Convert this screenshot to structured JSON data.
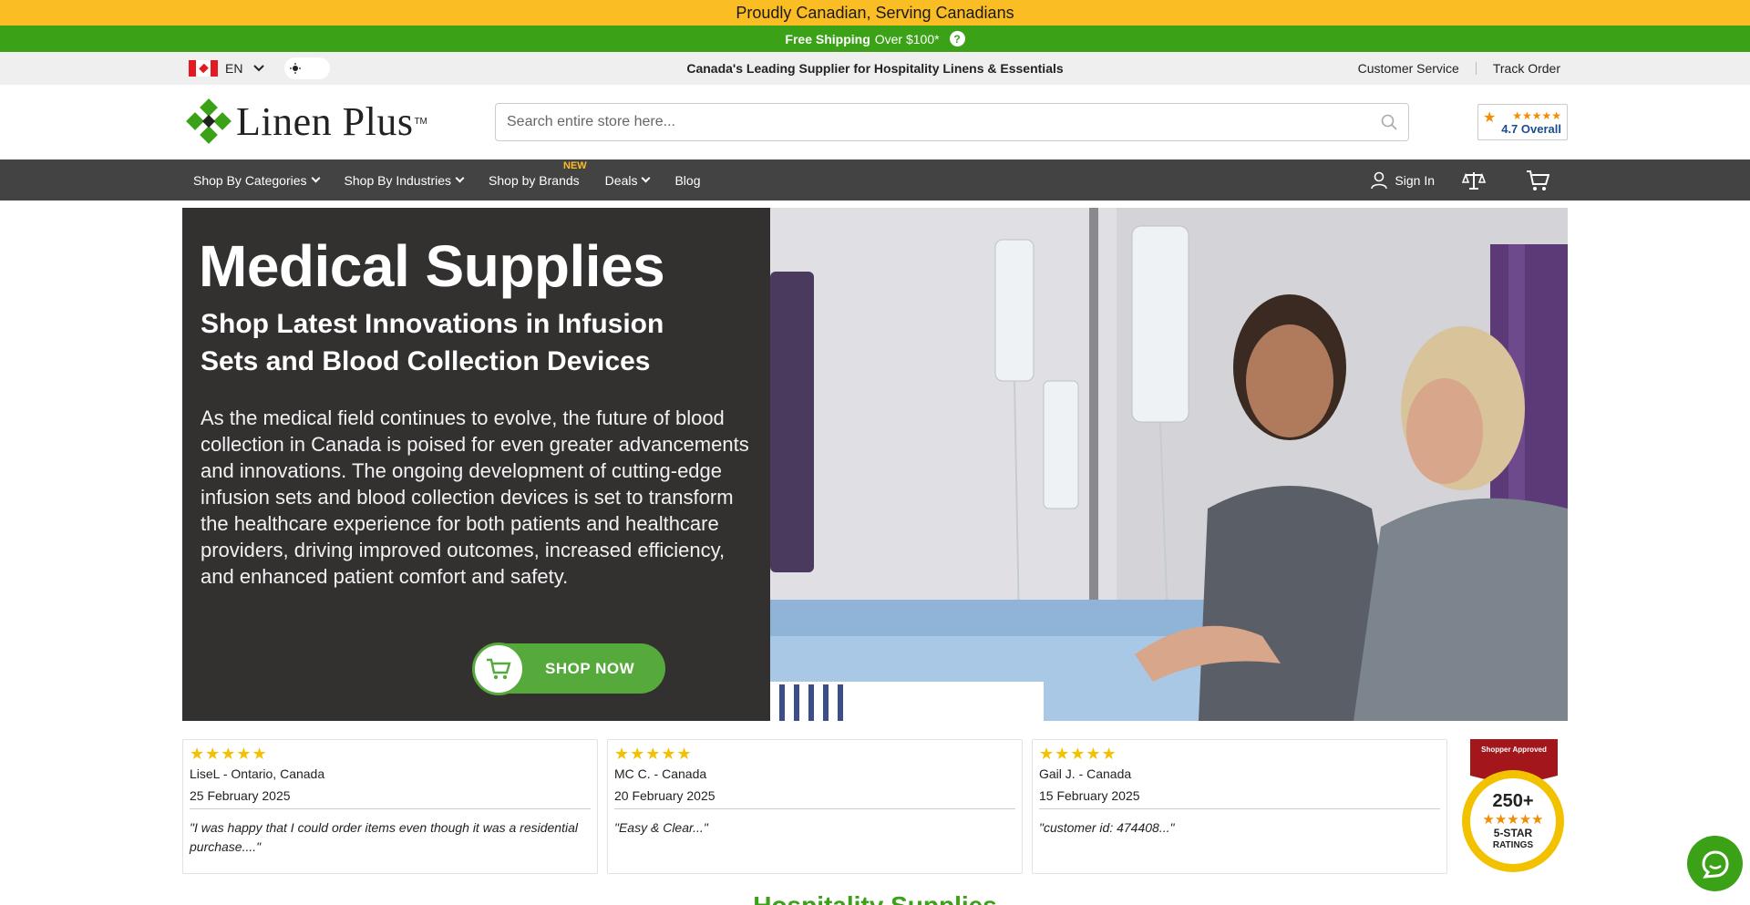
{
  "topbar": {
    "announcement": "Proudly Canadian, Serving Canadians",
    "shipping_strong": "Free Shipping",
    "shipping_rest": "Over $100*",
    "help_glyph": "?"
  },
  "utilbar": {
    "language": "EN",
    "tagline": "Canada's Leading Supplier for Hospitality Linens & Essentials",
    "links": [
      "Customer Service",
      "Track Order"
    ]
  },
  "header": {
    "logo_text": "Linen Plus",
    "logo_tm": "TM",
    "search_placeholder": "Search entire store here...",
    "rating_stars": "★★★★★",
    "rating_text": "4.7 Overall"
  },
  "nav": {
    "items": [
      {
        "label": "Shop By Categories",
        "dropdown": true
      },
      {
        "label": "Shop By Industries",
        "dropdown": true
      },
      {
        "label": "Shop by Brands",
        "dropdown": false,
        "tag": "NEW"
      },
      {
        "label": "Deals",
        "dropdown": true
      },
      {
        "label": "Blog",
        "dropdown": false
      }
    ],
    "sign_in": "Sign In"
  },
  "hero": {
    "title": "Medical Supplies",
    "subtitle": "Shop Latest Innovations in Infusion Sets and Blood Collection Devices",
    "body": "As the medical field continues to evolve, the future of blood collection in Canada is poised for even greater advancements and innovations. The ongoing development of cutting-edge infusion sets and blood collection devices is set to transform the healthcare experience for both patients and healthcare providers, driving improved outcomes, increased efficiency, and enhanced patient comfort and safety.",
    "cta": "SHOP NOW"
  },
  "reviews": [
    {
      "stars": "★★★★★",
      "name": "LiseL - Ontario, Canada",
      "date": "25 February 2025",
      "quote": "\"I was happy that I could order items even though it was a residential purchase....\""
    },
    {
      "stars": "★★★★★",
      "name": "MC C. - Canada",
      "date": "20 February 2025",
      "quote": "\"Easy & Clear...\""
    },
    {
      "stars": "★★★★★",
      "name": "Gail J. - Canada",
      "date": "15 February 2025",
      "quote": "\"customer id: 474408...\""
    }
  ],
  "approved_badge": {
    "brand": "Shopper Approved",
    "count": "250+",
    "label1": "5-STAR",
    "label2": "RATINGS"
  },
  "section_heading": "Hospitality Supplies",
  "colors": {
    "yellow": "#fbbd24",
    "green": "#3ba116",
    "nav": "#434343",
    "hero_dark": "#333030"
  },
  "icons": [
    "help-icon",
    "chevron-down-icon",
    "sun-icon",
    "search-icon",
    "user-icon",
    "compare-scale-icon",
    "cart-icon",
    "chat-icon"
  ]
}
